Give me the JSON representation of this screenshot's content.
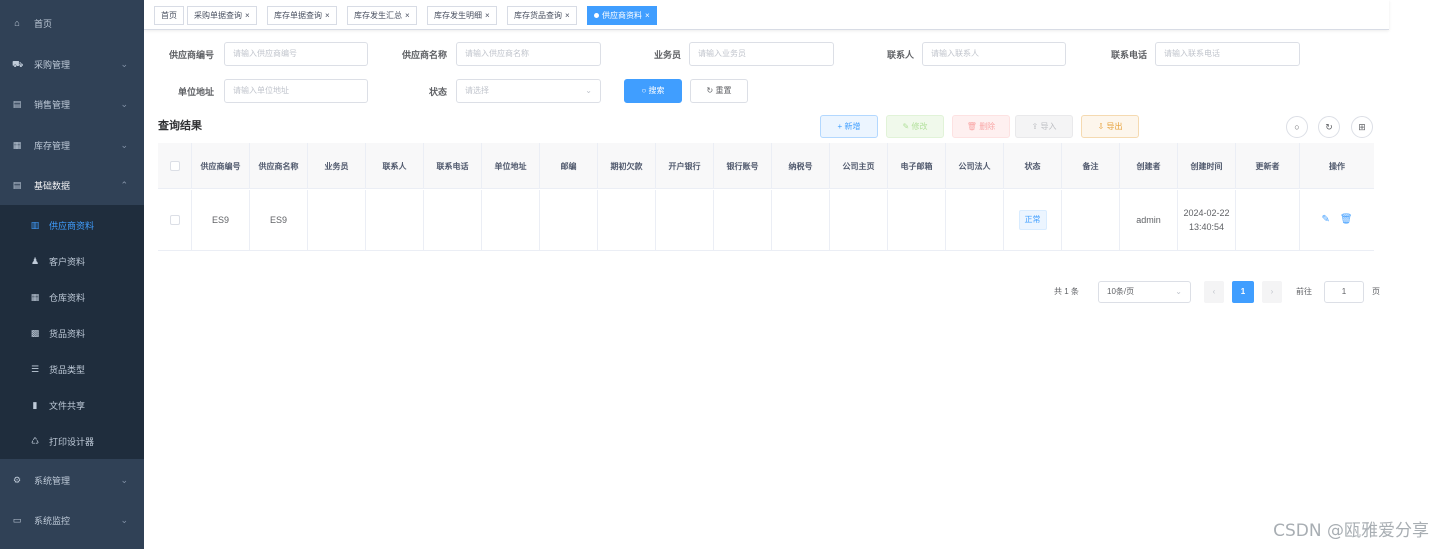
{
  "sidebar": {
    "items": [
      {
        "label": "首页",
        "icon": "home-icon",
        "glyph": "⌂"
      },
      {
        "label": "采购管理",
        "icon": "cart-icon",
        "glyph": "🛒"
      },
      {
        "label": "销售管理",
        "icon": "document-icon",
        "glyph": "▤"
      },
      {
        "label": "库存管理",
        "icon": "box-icon",
        "glyph": "▦"
      },
      {
        "label": "基础数据",
        "icon": "database-icon",
        "glyph": "▤"
      }
    ],
    "subitems": [
      {
        "label": "供应商资料",
        "glyph": "▥"
      },
      {
        "label": "客户资料",
        "glyph": "👤"
      },
      {
        "label": "仓库资料",
        "glyph": "▦"
      },
      {
        "label": "货品资料",
        "glyph": "▩"
      },
      {
        "label": "货品类型",
        "glyph": "☰"
      },
      {
        "label": "文件共享",
        "glyph": "▮"
      },
      {
        "label": "打印设计器",
        "glyph": "♺"
      }
    ],
    "bottom": [
      {
        "label": "系统管理",
        "glyph": "⚙"
      },
      {
        "label": "系统监控",
        "glyph": "🖵"
      }
    ]
  },
  "tabs": [
    {
      "label": "首页"
    },
    {
      "label": "采购单据查询"
    },
    {
      "label": "库存单据查询"
    },
    {
      "label": "库存发生汇总"
    },
    {
      "label": "库存发生明细"
    },
    {
      "label": "库存货品查询"
    },
    {
      "label": "供应商资料",
      "active": true
    }
  ],
  "search": {
    "supplier_code_label": "供应商编号",
    "supplier_code_placeholder": "请输入供应商编号",
    "supplier_name_label": "供应商名称",
    "supplier_name_placeholder": "请输入供应商名称",
    "salesman_label": "业务员",
    "salesman_placeholder": "请输入业务员",
    "contact_label": "联系人",
    "contact_placeholder": "请输入联系人",
    "phone_label": "联系电话",
    "phone_placeholder": "请输入联系电话",
    "address_label": "单位地址",
    "address_placeholder": "请输入单位地址",
    "status_label": "状态",
    "status_placeholder": "请选择",
    "query_button": "搜索",
    "reset_button": "重置"
  },
  "toolbar": {
    "section_title": "查询结果",
    "add": "新增",
    "edit": "修改",
    "delete": "删除",
    "import": "导入",
    "export": "导出"
  },
  "table": {
    "headers": [
      "供应商编号",
      "供应商名称",
      "业务员",
      "联系人",
      "联系电话",
      "单位地址",
      "邮编",
      "期初欠款",
      "开户银行",
      "银行账号",
      "纳税号",
      "公司主页",
      "电子邮箱",
      "公司法人",
      "状态",
      "备注",
      "创建者",
      "创建时间",
      "更新者",
      "操作"
    ],
    "rows": [
      {
        "code": "ES9",
        "name": "ES9",
        "status": "正常",
        "creator": "admin",
        "created": "2024-02-22 13:40:54"
      }
    ]
  },
  "pagination": {
    "total": "共 1 条",
    "page_size": "10条/页",
    "current": "1",
    "goto_label": "前往",
    "goto_value": "1",
    "page_unit": "页"
  },
  "watermark": "CSDN @瓯雅爱分享"
}
